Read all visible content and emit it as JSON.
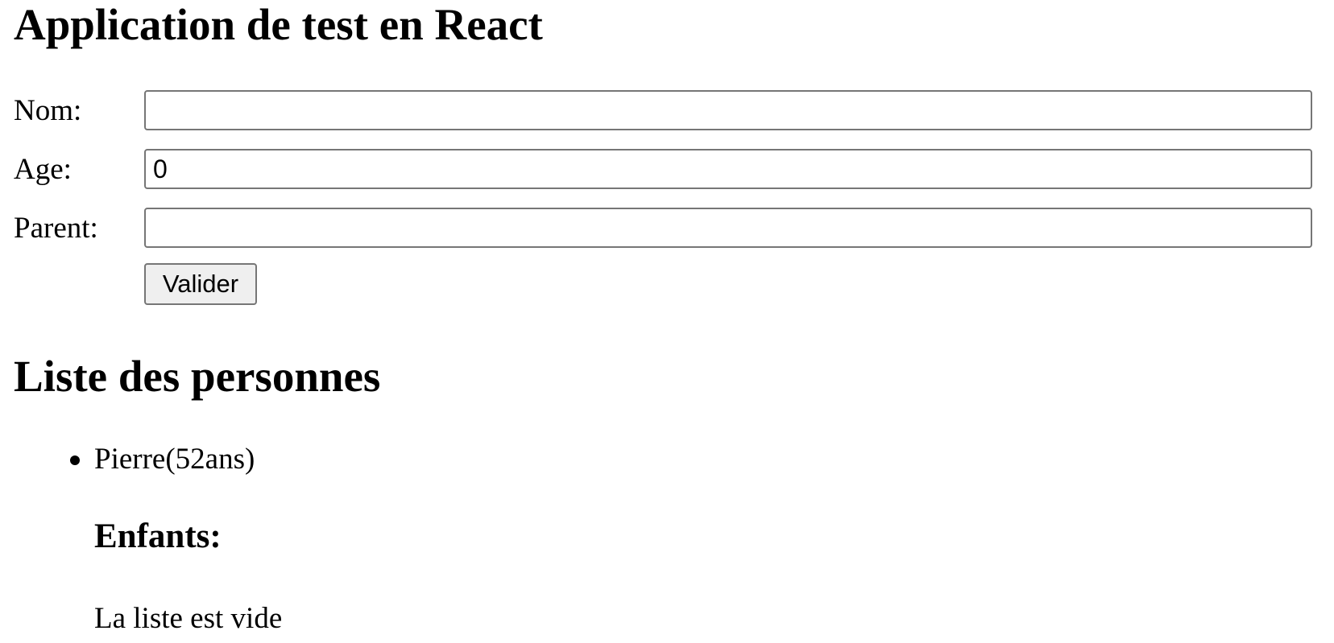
{
  "header": {
    "title": "Application de test en React"
  },
  "form": {
    "name_label": "Nom:",
    "name_value": "",
    "age_label": "Age:",
    "age_value": "0",
    "parent_label": "Parent:",
    "parent_value": "",
    "submit_label": "Valider"
  },
  "people": {
    "title": "Liste des personnes",
    "items": [
      {
        "label": "Pierre(52ans)",
        "children_title": "Enfants:",
        "children_empty_text": "La liste est vide"
      }
    ]
  }
}
